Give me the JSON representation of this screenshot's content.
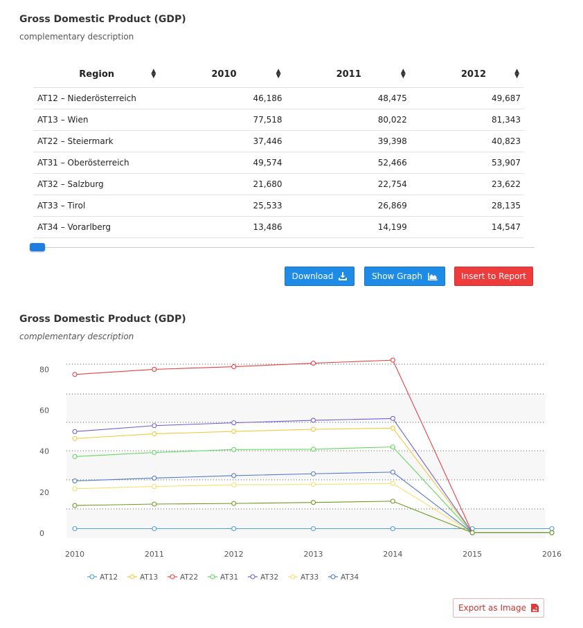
{
  "table_section": {
    "title": "Gross Domestic Product (GDP)",
    "subtitle": "complementary description",
    "headers": [
      "Region",
      "2010",
      "2011",
      "2012"
    ],
    "rows": [
      [
        "AT12 – Niederösterreich",
        "46,186",
        "48,475",
        "49,687"
      ],
      [
        "AT13 – Wien",
        "77,518",
        "80,022",
        "81,343"
      ],
      [
        "AT22 – Steiermark",
        "37,446",
        "39,398",
        "40,823"
      ],
      [
        "AT31 – Oberösterreich",
        "49,574",
        "52,466",
        "53,907"
      ],
      [
        "AT32 – Salzburg",
        "21,680",
        "22,754",
        "23,622"
      ],
      [
        "AT33 – Tirol",
        "25,533",
        "26,869",
        "28,135"
      ],
      [
        "AT34 – Vorarlberg",
        "13,486",
        "14,199",
        "14,547"
      ]
    ],
    "scroll_position": 0
  },
  "buttons": {
    "download": "Download",
    "show_graph": "Show Graph",
    "insert_report": "Insert to Report"
  },
  "chart_section": {
    "title": "Gross Domestic Product (GDP)",
    "subtitle": "complementary description",
    "export_label": "Export as Image"
  },
  "colors": {
    "primary": "#1e8be6",
    "danger": "#ee3b3b"
  },
  "chart_data": {
    "type": "line",
    "x": [
      2010,
      2011,
      2012,
      2013,
      2014,
      2015,
      2016
    ],
    "ylim": [
      0,
      90
    ],
    "yticks": [
      0,
      20,
      40,
      60,
      80
    ],
    "grid": true,
    "legend": "bottom-left",
    "series": [
      {
        "name": "AT12",
        "color": "#4a9fd8",
        "values": [
          2.2,
          2.2,
          2.2,
          2.2,
          2.2,
          2.2,
          2.2
        ]
      },
      {
        "name": "AT13",
        "color": "#f0c93b",
        "values": [
          46.2,
          48.5,
          49.7,
          50.7,
          51.3,
          0.2,
          0.2
        ]
      },
      {
        "name": "AT22",
        "color": "#e84040",
        "values": [
          77.5,
          80.0,
          81.3,
          83.0,
          84.5,
          0.2,
          0.2
        ]
      },
      {
        "name": "AT31",
        "color": "#5fd65f",
        "values": [
          37.4,
          39.4,
          40.8,
          41.0,
          42.1,
          0.2,
          0.2
        ]
      },
      {
        "name": "AT32",
        "color": "#6a5fd6",
        "values": [
          49.6,
          52.5,
          53.9,
          55.1,
          56.0,
          0.2,
          0.2
        ]
      },
      {
        "name": "AT33",
        "color": "#f5e06a",
        "values": [
          21.7,
          22.8,
          23.6,
          23.8,
          24.3,
          0.2,
          0.2
        ]
      },
      {
        "name": "AT34",
        "color": "#4f79c9",
        "values": [
          25.5,
          26.9,
          28.1,
          29.0,
          29.8,
          0.2,
          0.2
        ]
      },
      {
        "name": "",
        "color": "#6a9a1f",
        "values": [
          13.5,
          14.2,
          14.5,
          15.0,
          15.6,
          0.2,
          0.2
        ]
      }
    ]
  }
}
